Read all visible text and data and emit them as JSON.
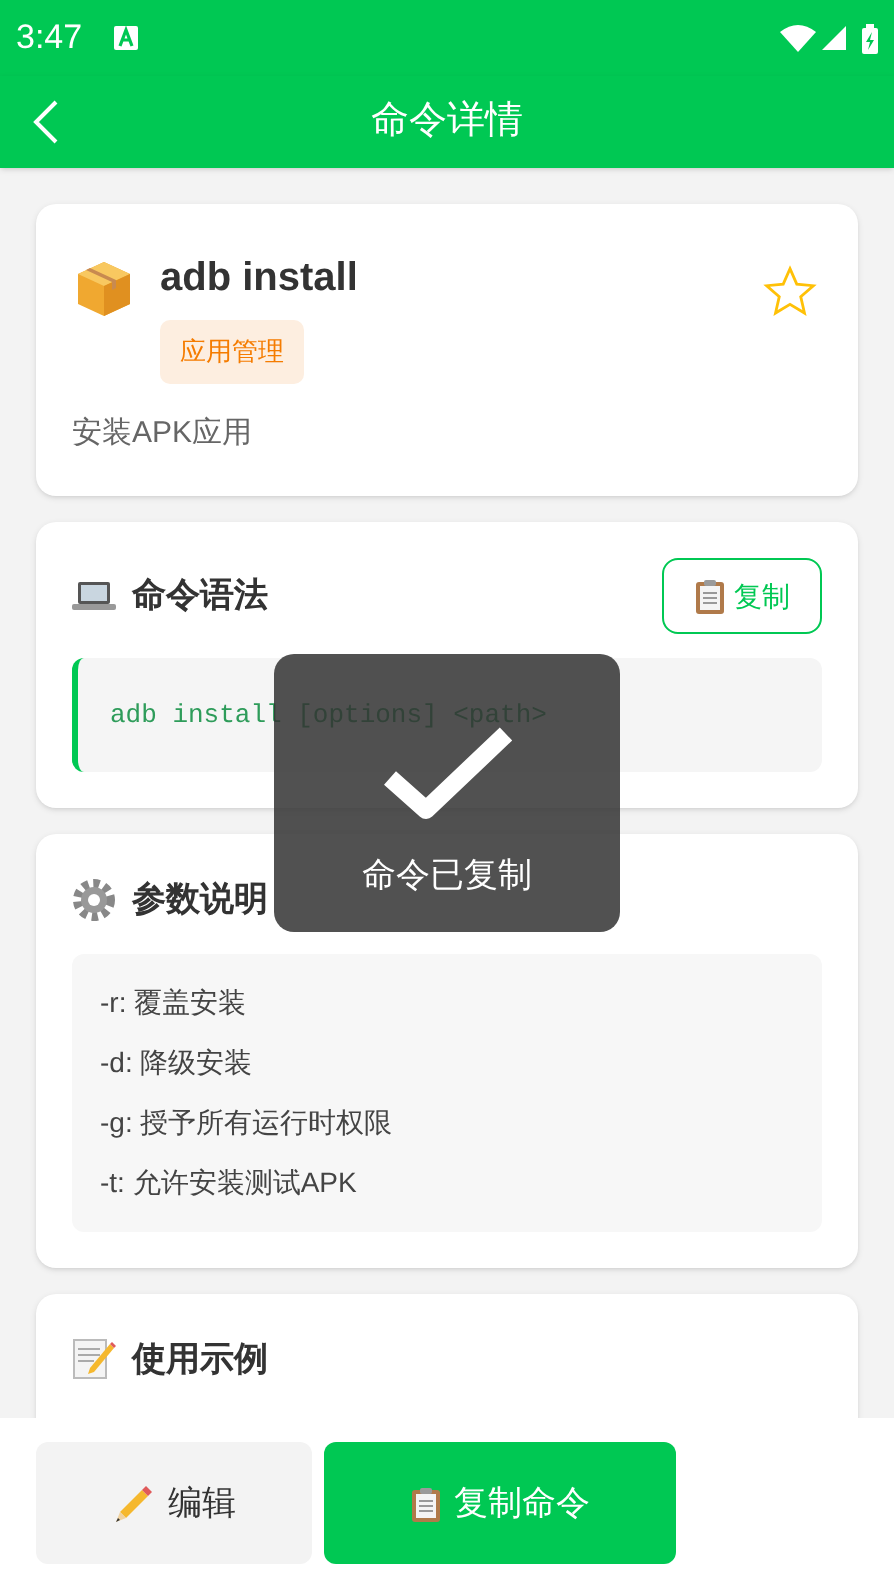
{
  "status_bar": {
    "time": "3:47"
  },
  "app_bar": {
    "title": "命令详情"
  },
  "command": {
    "name": "adb install",
    "category": "应用管理",
    "description": "安装APK应用",
    "favorite": false
  },
  "syntax": {
    "title": "命令语法",
    "copy_button": "复制",
    "code": "adb install [options] <path>"
  },
  "params": {
    "title": "参数说明",
    "items": [
      "-r: 覆盖安装",
      "-d: 降级安装",
      "-g: 授予所有运行时权限",
      "-t: 允许安装测试APK"
    ]
  },
  "examples": {
    "title": "使用示例"
  },
  "toast": {
    "message": "命令已复制"
  },
  "actions": [
    {
      "kind": "secondary",
      "label": "编辑"
    },
    {
      "kind": "primary",
      "label": "复制命令"
    }
  ]
}
